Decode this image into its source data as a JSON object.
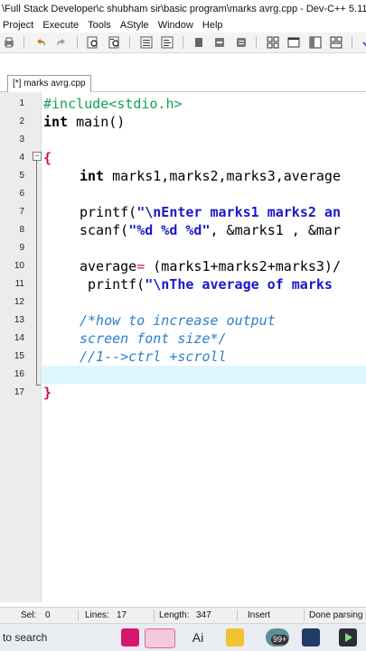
{
  "window": {
    "title": "\\Full Stack Developer\\c shubham sir\\basic program\\marks avrg.cpp - Dev-C++ 5.11"
  },
  "menu": {
    "items": [
      "Project",
      "Execute",
      "Tools",
      "AStyle",
      "Window",
      "Help"
    ]
  },
  "toolbar": {
    "icons": [
      "print-icon",
      "undo-icon",
      "redo-icon",
      "find-icon",
      "replace-icon",
      "indent-icon",
      "unindent-icon",
      "bookmark-icon",
      "toggle-comment-icon",
      "uncomment-icon",
      "grid-icon",
      "window-icon",
      "check-icon",
      "close-icon",
      "layout-icon"
    ]
  },
  "tabs": [
    {
      "label": "[*] marks avrg.cpp"
    }
  ],
  "editor": {
    "current_line": 16,
    "lines": [
      {
        "num": "1"
      },
      {
        "num": "2"
      },
      {
        "num": "3"
      },
      {
        "num": "4"
      },
      {
        "num": "5"
      },
      {
        "num": "6"
      },
      {
        "num": "7"
      },
      {
        "num": "8"
      },
      {
        "num": "9"
      },
      {
        "num": "10"
      },
      {
        "num": "11"
      },
      {
        "num": "12"
      },
      {
        "num": "13"
      },
      {
        "num": "14"
      },
      {
        "num": "15"
      },
      {
        "num": "16"
      },
      {
        "num": "17"
      }
    ],
    "tokens": {
      "l1_pp": "#include<stdio.h>",
      "l2_kw": "int",
      "l2_rest": " main()",
      "l4_brace": "{",
      "l5_kw": "int",
      "l5_rest": " marks1,marks2,marks3,average",
      "l7_fn": "printf(",
      "l7_str": "\"\\nEnter marks1 marks2 an",
      "l8_fn": "scanf(",
      "l8_str": "\"%d %d %d\"",
      "l8_rest": ", &marks1 , &mar",
      "l10_a": "average",
      "l10_op": "=",
      "l10_rest": " (marks1+marks2+marks3)/",
      "l11_fn": "printf(",
      "l11_str": "\"\\nThe average of marks ",
      "l13_cm": "/*how to increase output",
      "l14_cm": "screen font size*/",
      "l15_cm": "//1-->ctrl +scroll",
      "l17_brace": "}"
    }
  },
  "statusbar": {
    "sel_label": "Sel:",
    "sel_value": "0",
    "lines_label": "Lines:",
    "lines_value": "17",
    "length_label": "Length:",
    "length_value": "347",
    "mode": "Insert",
    "message": "Done parsing i"
  },
  "taskbar": {
    "search_text": "to search",
    "badge": "99+"
  },
  "colors": {
    "current_line_bg": "#dff6ff",
    "preprocessor": "#13a15a",
    "string": "#1818c8",
    "comment": "#2a7fd0",
    "brace": "#d0103a"
  }
}
